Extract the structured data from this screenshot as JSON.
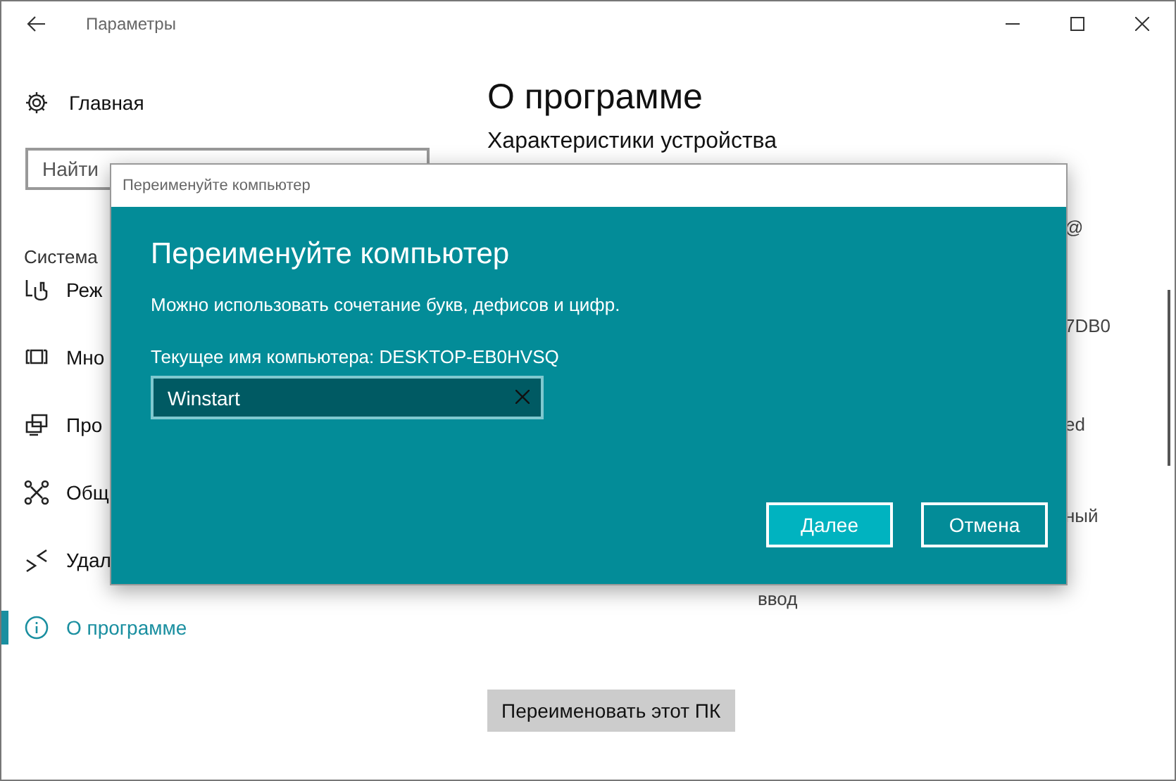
{
  "window": {
    "title": "Параметры"
  },
  "sidebar": {
    "home": "Главная",
    "search": {
      "placeholder": "Найти"
    },
    "section": "Система",
    "items": [
      {
        "label": "Реж",
        "selected": false
      },
      {
        "label": "Мно",
        "selected": false
      },
      {
        "label": "Про",
        "selected": false
      },
      {
        "label": "Общ",
        "selected": false
      },
      {
        "label": "Удал",
        "selected": false
      },
      {
        "label": "О программе",
        "selected": true
      }
    ]
  },
  "main": {
    "title": "О программе",
    "subtitle": "Характеристики устройства",
    "specs": [
      "@",
      "7DB0",
      "ed",
      "ный",
      "ввод"
    ],
    "rename_button": "Переименовать этот ПК"
  },
  "dialog": {
    "window_title": "Переименуйте компьютер",
    "heading": "Переименуйте компьютер",
    "hint": "Можно использовать сочетание букв, дефисов и цифр.",
    "current_name": "Текущее имя компьютера: DESKTOP-EB0HVSQ",
    "field": {
      "value": "Winstart"
    },
    "buttons": [
      {
        "label": "Далее",
        "kind": "primary"
      },
      {
        "label": "Отмена",
        "kind": "secondary"
      }
    ]
  }
}
